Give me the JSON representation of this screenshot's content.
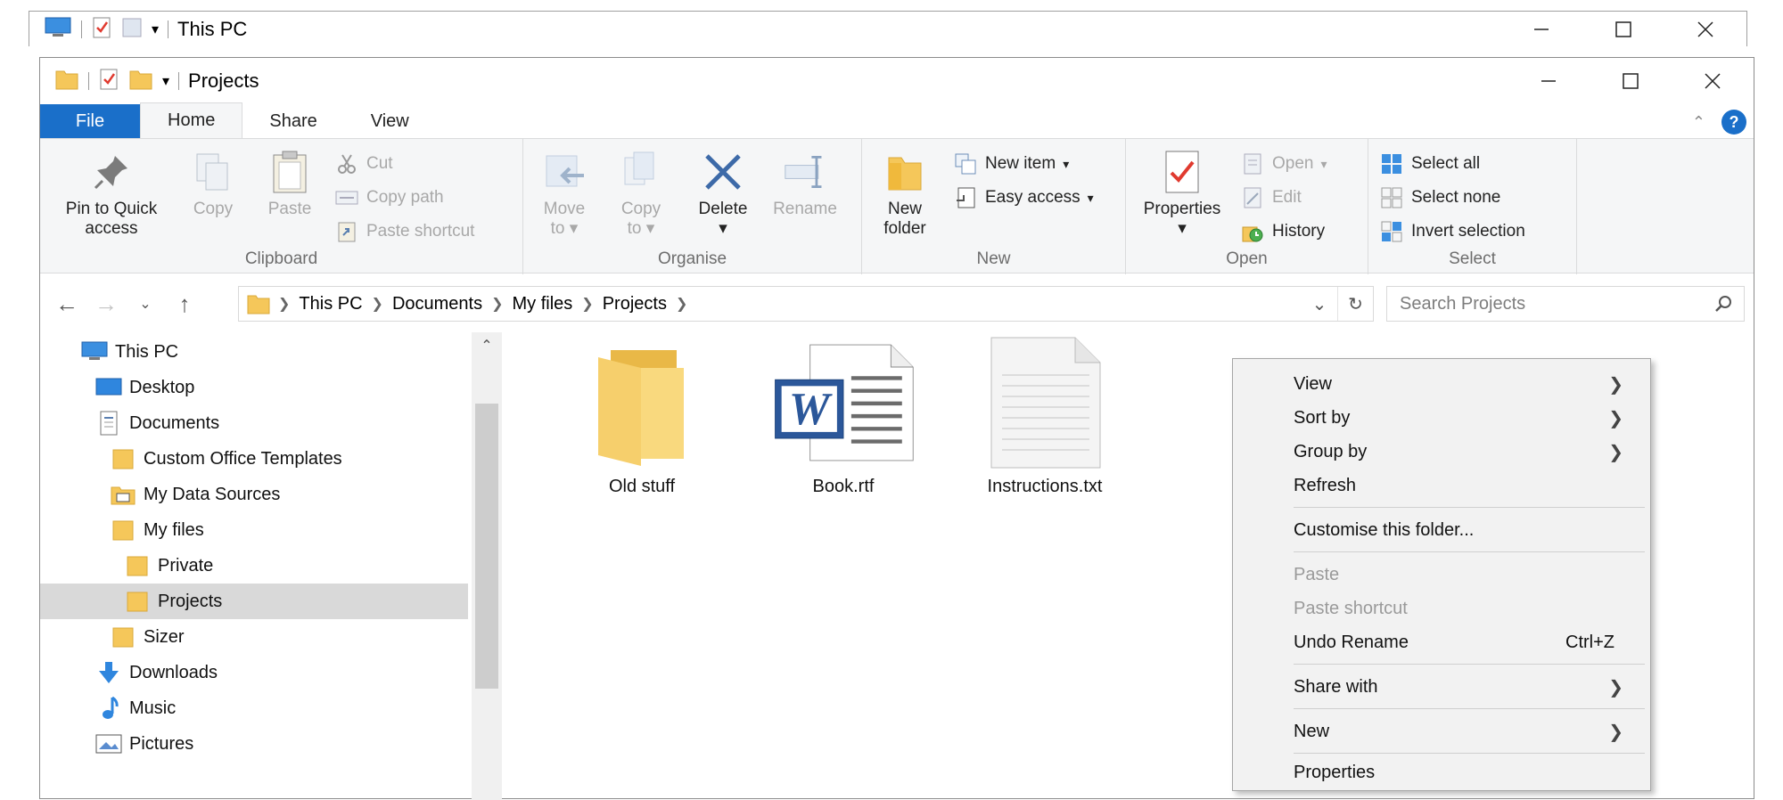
{
  "background_window": {
    "title": "This PC"
  },
  "window": {
    "title": "Projects"
  },
  "tabs": [
    {
      "label": "File"
    },
    {
      "label": "Home"
    },
    {
      "label": "Share"
    },
    {
      "label": "View"
    }
  ],
  "ribbon": {
    "clipboard": {
      "label": "Clipboard",
      "pin": "Pin to Quick access",
      "pin_line1": "Pin to Quick",
      "pin_line2": "access",
      "copy": "Copy",
      "paste": "Paste",
      "cut": "Cut",
      "copy_path": "Copy path",
      "paste_shortcut": "Paste shortcut"
    },
    "organise": {
      "label": "Organise",
      "move_to_line1": "Move",
      "move_to_line2": "to",
      "copy_to_line1": "Copy",
      "copy_to_line2": "to",
      "delete": "Delete",
      "rename": "Rename"
    },
    "new": {
      "label": "New",
      "new_folder_line1": "New",
      "new_folder_line2": "folder",
      "new_item": "New item",
      "easy_access": "Easy access"
    },
    "open": {
      "label": "Open",
      "properties": "Properties",
      "open": "Open",
      "edit": "Edit",
      "history": "History"
    },
    "select": {
      "label": "Select",
      "select_all": "Select all",
      "select_none": "Select none",
      "invert_selection": "Invert selection"
    }
  },
  "address": {
    "crumbs": [
      "This PC",
      "Documents",
      "My files",
      "Projects"
    ],
    "search_placeholder": "Search Projects"
  },
  "tree": [
    {
      "label": "This PC",
      "icon": "computer-icon"
    },
    {
      "label": "Desktop",
      "icon": "desktop-icon"
    },
    {
      "label": "Documents",
      "icon": "documents-icon"
    },
    {
      "label": "Custom Office Templates",
      "icon": "folder-icon"
    },
    {
      "label": "My Data Sources",
      "icon": "data-sources-icon"
    },
    {
      "label": "My files",
      "icon": "folder-icon"
    },
    {
      "label": "Private",
      "icon": "folder-icon"
    },
    {
      "label": "Projects",
      "icon": "folder-icon",
      "selected": true
    },
    {
      "label": "Sizer",
      "icon": "folder-icon"
    },
    {
      "label": "Downloads",
      "icon": "downloads-icon"
    },
    {
      "label": "Music",
      "icon": "music-icon"
    },
    {
      "label": "Pictures",
      "icon": "pictures-icon"
    }
  ],
  "files": [
    {
      "name": "Old stuff",
      "icon": "folder-icon"
    },
    {
      "name": "Book.rtf",
      "icon": "word-document-icon"
    },
    {
      "name": "Instructions.txt",
      "icon": "text-document-icon"
    }
  ],
  "context_menu": {
    "view": "View",
    "sort_by": "Sort by",
    "group_by": "Group by",
    "refresh": "Refresh",
    "customise": "Customise this folder...",
    "paste": "Paste",
    "paste_shortcut": "Paste shortcut",
    "undo_rename": "Undo Rename",
    "undo_shortcut": "Ctrl+Z",
    "share_with": "Share with",
    "new": "New",
    "properties": "Properties"
  },
  "colors": {
    "accent": "#1a6fc9",
    "folder": "#f5c75a",
    "ribbon_bg": "#f5f6f7",
    "selection": "#d9d9d9"
  }
}
